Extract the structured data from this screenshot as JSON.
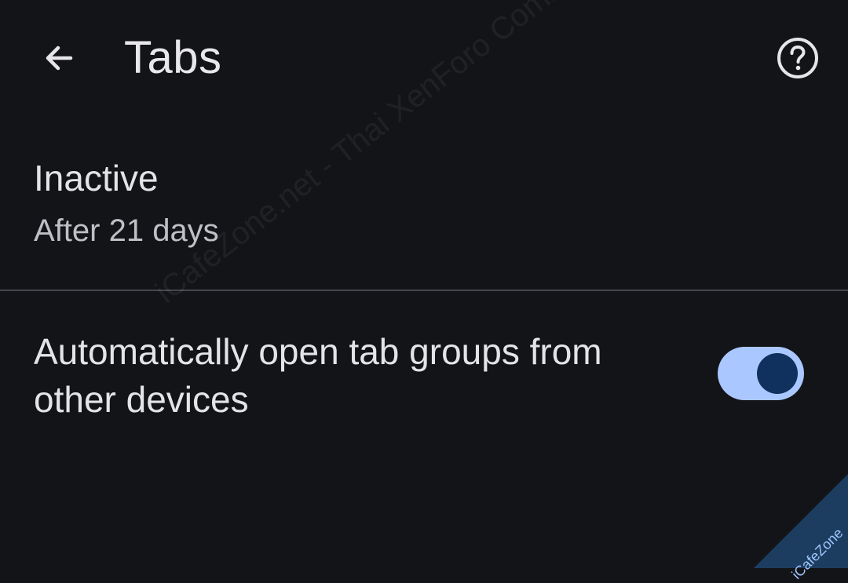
{
  "header": {
    "title": "Tabs",
    "back_icon": "arrow-back-icon",
    "help_icon": "help-circle-icon"
  },
  "settings": {
    "inactive": {
      "title": "Inactive",
      "summary": "After 21 days"
    },
    "auto_open_tab_groups": {
      "label": "Automatically open tab groups from other devices",
      "enabled": true
    }
  },
  "watermark": {
    "text": "iCafeZone.net - Thai XenForo Community",
    "corner_text": "iCafeZone"
  },
  "colors": {
    "background": "#131418",
    "text_primary": "#e4e4e7",
    "text_secondary": "#bfc0c6",
    "divider": "#45464c",
    "toggle_track": "#aac7ff",
    "toggle_thumb": "#10305e"
  }
}
